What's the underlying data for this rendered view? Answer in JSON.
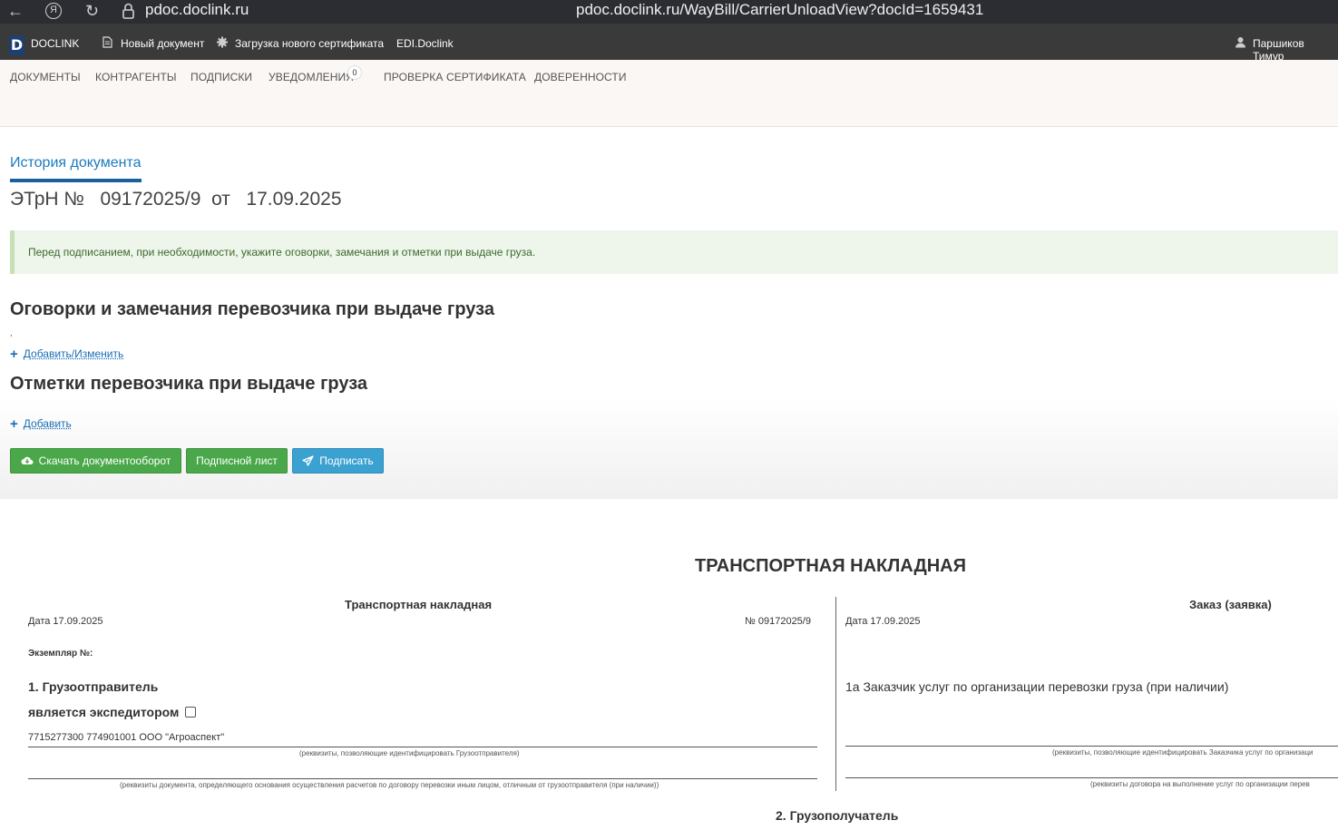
{
  "browser": {
    "domain": "pdoc.doclink.ru",
    "url": "pdoc.doclink.ru/WayBill/CarrierUnloadView?docId=1659431",
    "yandex_letter": "Я"
  },
  "appbar": {
    "logo_letter": "D",
    "brand": "DOCLINK",
    "new_document": "Новый документ",
    "upload_certificate": "Загрузка нового сертификата",
    "edi": "EDI.Doclink",
    "user": "Паршиков Тимур"
  },
  "nav": {
    "documents": "ДОКУМЕНТЫ",
    "counterparties": "КОНТРАГЕНТЫ",
    "subscriptions": "ПОДПИСКИ",
    "notifications": "УВЕДОМЛЕНИЯ",
    "notifications_count": "0",
    "check_certificate": "ПРОВЕРКА СЕРТИФИКАТА",
    "power_of_attorney": "ДОВЕРЕННОСТИ"
  },
  "history_tab": "История документа",
  "doc_title": "ЭТрН №   09172025/9  от   17.09.2025",
  "alert": "Перед подписанием, при необходимости, укажите оговорки, замечания и отметки при выдаче груза.",
  "sections": {
    "remarks_title": "Оговорки и замечания перевозчика при выдаче груза",
    "remarks_comma": ",",
    "remarks_link": "Добавить/Изменить",
    "marks_title": "Отметки перевозчика при выдаче груза",
    "marks_link": "Добавить"
  },
  "buttons": {
    "download": "Скачать документооборот",
    "signature_sheet": "Подписной лист",
    "sign": "Подписать"
  },
  "document": {
    "title": "ТРАНСПОРТНАЯ НАКЛАДНАЯ",
    "left_header": "Транспортная накладная",
    "left_date": "Дата  17.09.2025",
    "left_number": "№   09172025/9",
    "copy_label": "Экземпляр №:",
    "shipper_heading": "1. Грузоотправитель",
    "is_forwarder": "является экспедитором",
    "shipper_value": "7715277300 774901001 ООО \"Агроаспект\"",
    "shipper_caption": "(реквизиты, позволяющие идентифицировать Грузоотправителя)",
    "settlement_caption": "(реквизиты документа, определяющего основания осуществления расчетов по договору перевозки иным лицом, отличным от грузоотправителя (при наличии))",
    "right_header": "Заказ (заявка)",
    "right_date": "Дата 17.09.2025",
    "customer_heading": "1а Заказчик услуг по организации перевозки груза (при наличии)",
    "customer_caption": "(реквизиты, позволяющие идентифицировать Заказчика услуг по организаци",
    "contract_caption": "(реквизиты договора на выполнение услуг по организации перев",
    "consignee_heading": "2. Грузополучатель"
  }
}
